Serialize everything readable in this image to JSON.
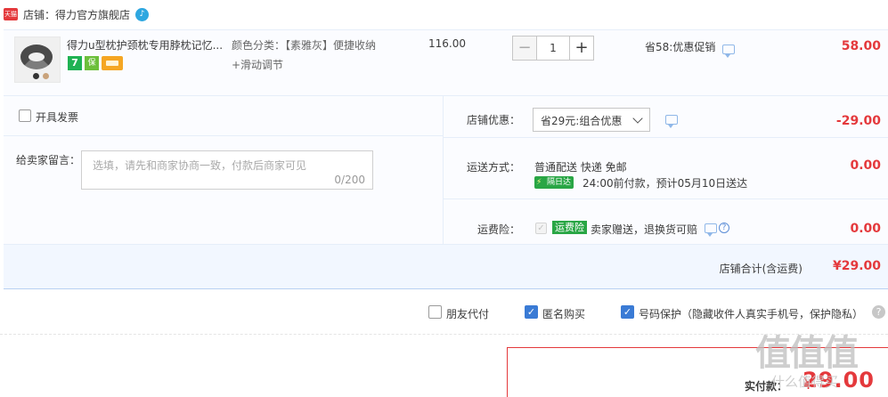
{
  "shop": {
    "badge": "天猫",
    "name": "店铺：得力官方旗舰店",
    "ww_glyph": "♪"
  },
  "item": {
    "title": "得力u型枕护颈枕专用脖枕记忆...",
    "service_badge_1": "7",
    "service_badge_2": "保",
    "sku_label": "颜色分类：【素雅灰】便捷收纳",
    "sku_label_2": "+滑动调节",
    "unit_price": "116.00",
    "qty_minus": "−",
    "quantity": "1",
    "qty_plus": "+",
    "promo": "省58:优惠促销",
    "total": "58.00"
  },
  "invoice": {
    "label": "开具发票"
  },
  "message": {
    "label": "给卖家留言：",
    "placeholder": "选填，请先和商家协商一致，付款后商家可见",
    "count": "0/200"
  },
  "shop_discount": {
    "label": "店铺优惠：",
    "selected": "省29元:组合优惠",
    "amount": "-29.00"
  },
  "shipping": {
    "label": "运送方式：",
    "method": "普通配送 快递 免邮",
    "badge": "隔日达",
    "time": "24:00前付款，预计05月10日送达",
    "amount": "0.00"
  },
  "insurance": {
    "label": "运费险：",
    "check": "✓",
    "badge": "运费险",
    "text": "卖家赠送，退换货可赔",
    "help": "?",
    "amount": "0.00"
  },
  "subtotal": {
    "label": "店铺合计(含运费)",
    "amount": "¥29.00"
  },
  "options": {
    "friend_pay": "朋友代付",
    "anonymous": "匿名购买",
    "number_protect": "号码保护（隐藏收件人真实手机号，保护隐私）",
    "check_glyph": "✓",
    "help_glyph": "?"
  },
  "pay": {
    "label": "实付款：",
    "yen": "¥",
    "amount": "29.00"
  },
  "watermark": {
    "logo": "值值值",
    "text": "什么值得买"
  },
  "colors": {
    "price_red": "#e4393c",
    "accent_blue": "#3a7bd5",
    "green_badge": "#29a645",
    "row_bg": "#fbfcff",
    "subtotal_bg": "#f2f7ff"
  },
  "icons": [
    "tmall-badge-icon",
    "wangwang-icon",
    "chat-icon",
    "chevron-down-icon",
    "help-icon",
    "lightning-icon",
    "check-icon"
  ]
}
